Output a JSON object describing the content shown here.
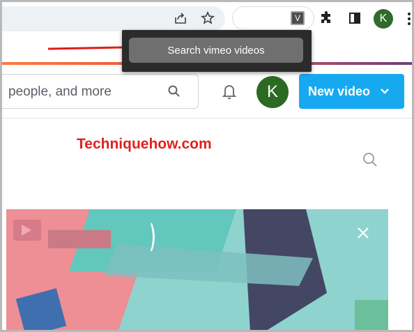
{
  "browser": {
    "tooltip_text": "Search vimeo videos",
    "extension_letter": "V",
    "profile_initial": "K"
  },
  "vimeo_header": {
    "search_placeholder": "people, and more",
    "avatar_initial": "K",
    "new_video_label": "New video"
  },
  "watermark": "Techniquehow.com",
  "colors": {
    "new_video_bg": "#17a9f0",
    "avatar_green": "#2c6a23",
    "watermark_red": "#e0211d",
    "tooltip_bg": "#2b2b2b"
  }
}
